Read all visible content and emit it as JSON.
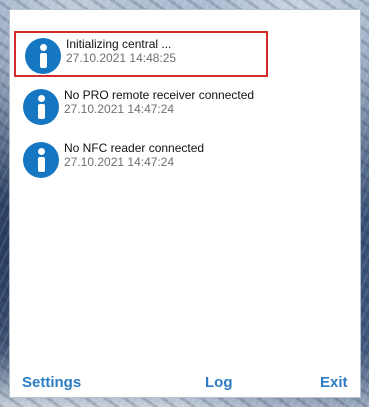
{
  "notifications": [
    {
      "icon": "info-icon",
      "message": "Initializing central ...",
      "timestamp": "27.10.2021 14:48:25",
      "selected": true
    },
    {
      "icon": "info-icon",
      "message": "No PRO remote receiver connected",
      "timestamp": "27.10.2021 14:47:24",
      "selected": false
    },
    {
      "icon": "info-icon",
      "message": "No NFC reader connected",
      "timestamp": "27.10.2021 14:47:24",
      "selected": false
    }
  ],
  "footer": {
    "settings_label": "Settings",
    "log_label": "Log",
    "exit_label": "Exit"
  },
  "colors": {
    "accent": "#2b7cc4",
    "info_icon": "#1577c2",
    "selection_border": "#d42b2b",
    "timestamp": "#6f6f6f"
  }
}
